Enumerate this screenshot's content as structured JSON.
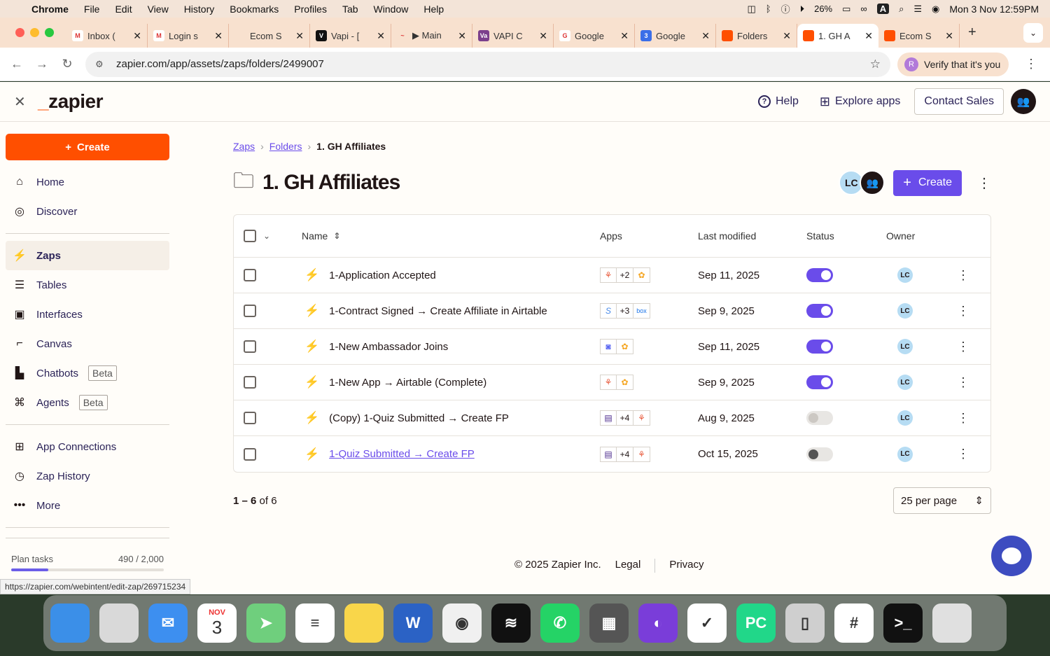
{
  "menubar": {
    "app": "Chrome",
    "items": [
      "File",
      "Edit",
      "View",
      "History",
      "Bookmarks",
      "Profiles",
      "Tab",
      "Window",
      "Help"
    ],
    "battery": "26%",
    "datetime": "Mon 3 Nov  12:59PM",
    "input": "A"
  },
  "tabs": [
    {
      "title": "Inbox (",
      "color": "#ffffff",
      "glyph": "M"
    },
    {
      "title": "Login s",
      "color": "#ffffff",
      "glyph": "M"
    },
    {
      "title": "Ecom S",
      "color": "#f8e1cf",
      "glyph": ""
    },
    {
      "title": "Vapi - [",
      "color": "#111111",
      "glyph": "V"
    },
    {
      "title": "▶ Main",
      "color": "#f8e1cf",
      "glyph": "~"
    },
    {
      "title": "VAPI C",
      "color": "#7b3f8c",
      "glyph": "Va"
    },
    {
      "title": "Google",
      "color": "#ffffff",
      "glyph": "G"
    },
    {
      "title": "Google",
      "color": "#3a6ee8",
      "glyph": "3"
    },
    {
      "title": "Folders",
      "color": "#ff4f00",
      "glyph": ""
    },
    {
      "title": "1. GH A",
      "color": "#ff4f00",
      "glyph": "",
      "active": true
    },
    {
      "title": "Ecom S",
      "color": "#ff4f00",
      "glyph": ""
    }
  ],
  "address": {
    "url": "zapier.com/app/assets/zaps/folders/2499007",
    "verify": "Verify that it's you",
    "profile_initial": "R"
  },
  "header": {
    "logo": "zapier",
    "help": "Help",
    "explore": "Explore apps",
    "contact": "Contact Sales"
  },
  "sidebar": {
    "create": "Create",
    "group1": [
      {
        "label": "Home",
        "icon": "⌂"
      },
      {
        "label": "Discover",
        "icon": "◎"
      }
    ],
    "group2": [
      {
        "label": "Zaps",
        "icon": "⚡",
        "selected": true
      },
      {
        "label": "Tables",
        "icon": "☰"
      },
      {
        "label": "Interfaces",
        "icon": "▣"
      },
      {
        "label": "Canvas",
        "icon": "⌐"
      },
      {
        "label": "Chatbots",
        "icon": "▙",
        "badge": "Beta"
      },
      {
        "label": "Agents",
        "icon": "⌘",
        "badge": "Beta"
      }
    ],
    "group3": [
      {
        "label": "App Connections",
        "icon": "⊞"
      },
      {
        "label": "Zap History",
        "icon": "◷"
      },
      {
        "label": "More",
        "icon": "•••"
      }
    ],
    "plan_label": "Plan tasks",
    "plan_value": "490 / 2,000",
    "plan_fraction": 0.245
  },
  "breadcrumb": {
    "zaps": "Zaps",
    "folders": "Folders",
    "current": "1. GH Affiliates"
  },
  "page": {
    "title": "1. GH Affiliates",
    "owner_initials": "LC",
    "create": "Create"
  },
  "table": {
    "headers": {
      "name": "Name",
      "apps": "Apps",
      "modified": "Last modified",
      "status": "Status",
      "owner": "Owner"
    },
    "rows": [
      {
        "name": "1-Application Accepted",
        "apps": [
          "⚘",
          "+2",
          "✿"
        ],
        "modified": "Sep 11, 2025",
        "on": true,
        "owner": "LC"
      },
      {
        "name": "1-Contract Signed → Create Affiliate in Airtable",
        "apps": [
          "S",
          "+3",
          "box"
        ],
        "modified": "Sep 9, 2025",
        "on": true,
        "owner": "LC"
      },
      {
        "name": "1-New Ambassador Joins",
        "apps": [
          "◙",
          "✿"
        ],
        "modified": "Sep 11, 2025",
        "on": true,
        "owner": "LC"
      },
      {
        "name": "1-New App → Airtable (Complete)",
        "apps": [
          "⚘",
          "✿"
        ],
        "modified": "Sep 9, 2025",
        "on": true,
        "owner": "LC"
      },
      {
        "name": "(Copy) 1-Quiz Submitted → Create FP",
        "apps": [
          "▤",
          "+4",
          "⚘"
        ],
        "modified": "Aug 9, 2025",
        "on": false,
        "owner": "LC"
      },
      {
        "name": "1-Quiz Submitted → Create FP",
        "apps": [
          "▤",
          "+4",
          "⚘"
        ],
        "modified": "Oct 15, 2025",
        "on": false,
        "owner": "LC",
        "link": true
      }
    ]
  },
  "pager": {
    "range": "1 – 6",
    "of": "of 6",
    "perpage": "25 per page"
  },
  "footer": {
    "copyright": "© 2025 Zapier Inc.",
    "legal": "Legal",
    "privacy": "Privacy"
  },
  "status_url": "https://zapier.com/webintent/edit-zap/269715234",
  "dock": [
    {
      "name": "Finder",
      "color": "#3b8fe8",
      "glyph": ""
    },
    {
      "name": "Launchpad",
      "color": "#d9d9d9",
      "glyph": ""
    },
    {
      "name": "Mail",
      "color": "#3d8ff0",
      "glyph": "✉"
    },
    {
      "name": "Calendar",
      "color": "#ffffff",
      "glyph": "3",
      "month": "NOV"
    },
    {
      "name": "Maps",
      "color": "#6fcf7d",
      "glyph": "➤"
    },
    {
      "name": "Reminders",
      "color": "#ffffff",
      "glyph": "≡"
    },
    {
      "name": "Notes",
      "color": "#f9d64a",
      "glyph": ""
    },
    {
      "name": "Word",
      "color": "#2b62c5",
      "glyph": "W"
    },
    {
      "name": "Chrome",
      "color": "#f0f0f0",
      "glyph": "◉"
    },
    {
      "name": "Spotify",
      "color": "#111111",
      "glyph": "≋"
    },
    {
      "name": "WhatsApp",
      "color": "#25d366",
      "glyph": "✆"
    },
    {
      "name": "Calculator",
      "color": "#555555",
      "glyph": "▦"
    },
    {
      "name": "Firefox",
      "color": "#7a3dd9",
      "glyph": "◐"
    },
    {
      "name": "TickTick",
      "color": "#ffffff",
      "glyph": "✓"
    },
    {
      "name": "PyCharm",
      "color": "#21d789",
      "glyph": "PC"
    },
    {
      "name": "iPhone Mirroring",
      "color": "#cfcfcf",
      "glyph": "▯"
    },
    {
      "name": "Slack",
      "color": "#ffffff",
      "glyph": "#"
    },
    {
      "name": "Terminal",
      "color": "#111111",
      "glyph": ">_"
    },
    {
      "name": "Trash",
      "color": "#e0e0e0",
      "glyph": ""
    }
  ]
}
